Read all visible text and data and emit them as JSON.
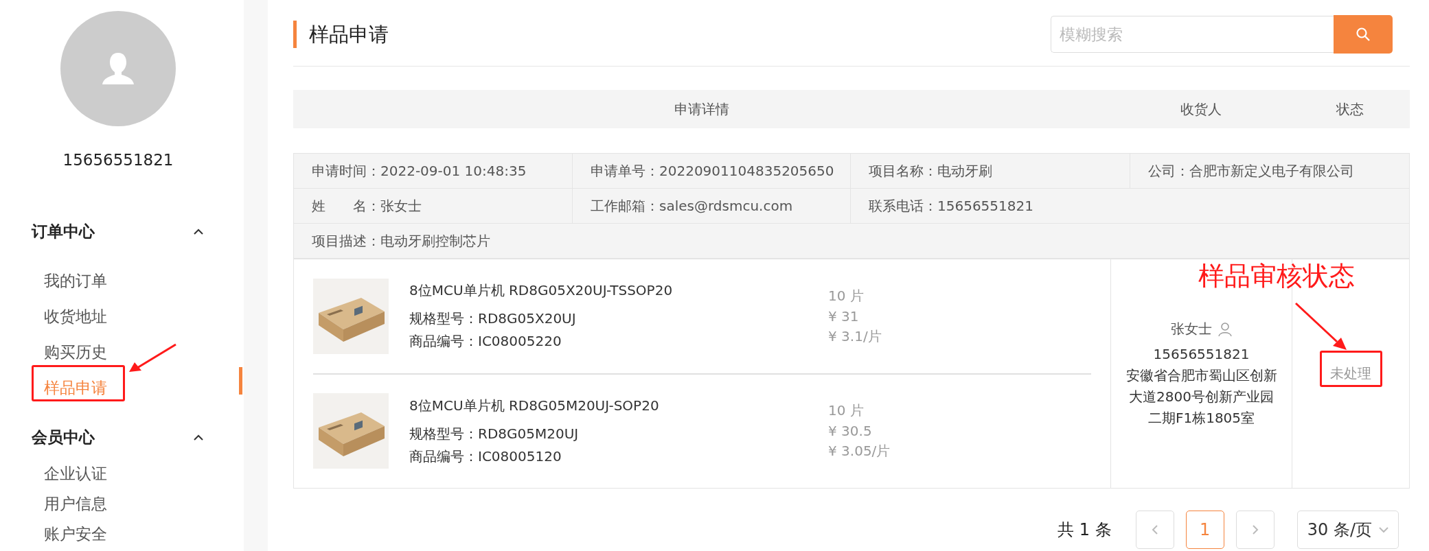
{
  "user": {
    "phone": "15656551821"
  },
  "menu": [
    {
      "label": "订单中心",
      "expanded": true,
      "children": [
        {
          "label": "我的订单",
          "selected": false
        },
        {
          "label": "收货地址",
          "selected": false
        },
        {
          "label": "购买历史",
          "selected": false
        },
        {
          "label": "样品申请",
          "selected": true
        }
      ]
    },
    {
      "label": "会员中心",
      "expanded": true,
      "children": [
        {
          "label": "企业认证",
          "selected": false
        },
        {
          "label": "用户信息",
          "selected": false
        },
        {
          "label": "账户安全",
          "selected": false
        }
      ]
    }
  ],
  "page_title": "样品申请",
  "search": {
    "placeholder": "模糊搜索"
  },
  "table": {
    "columns": [
      "申请详情",
      "收货人",
      "状态"
    ]
  },
  "application": {
    "info_rows": [
      [
        "申请时间：2022-09-01 10:48:35",
        "申请单号：20220901104835205650",
        "项目名称：电动牙刷",
        "公司：合肥市新定义电子有限公司"
      ],
      [
        "姓　　名：张女士",
        "工作邮箱：sales@rdsmcu.com",
        "联系电话：15656551821"
      ],
      [
        "项目描述：电动牙刷控制芯片"
      ]
    ],
    "items": [
      {
        "name": "8位MCU单片机 RD8G05X20UJ-TSSOP20",
        "spec": "规格型号：RD8G05X20UJ",
        "code": "商品编号：IC08005220",
        "quantity": "10 片",
        "total": "¥ 31",
        "unit_price": "¥ 3.1/片"
      },
      {
        "name": "8位MCU单片机 RD8G05M20UJ-SOP20",
        "spec": "规格型号：RD8G05M20UJ",
        "code": "商品编号：IC08005120",
        "quantity": "10 片",
        "total": "¥ 30.5",
        "unit_price": "¥ 3.05/片"
      }
    ],
    "receiver": {
      "name": "张女士",
      "phone": "15656551821",
      "address": "安徽省合肥市蜀山区创新大道2800号创新产业园二期F1栋1805室"
    },
    "status": "未处理"
  },
  "pagination": {
    "total": "共 1 条",
    "pages": [
      {
        "label": "1",
        "selected": true
      }
    ],
    "page_size": "30 条/页"
  },
  "annotation": {
    "label": "样品审核状态"
  }
}
